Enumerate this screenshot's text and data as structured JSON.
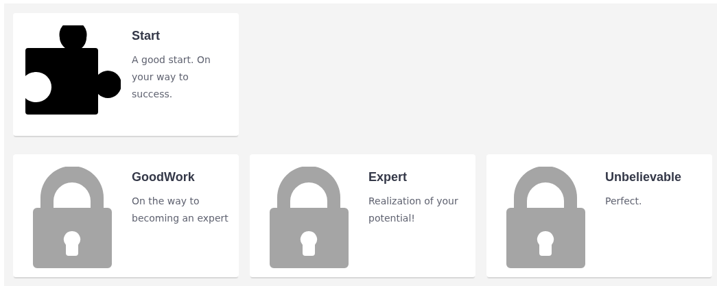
{
  "rows": [
    {
      "achievements": [
        {
          "title": "Start",
          "description": "A good start. On your way to success.",
          "unlocked": true
        }
      ]
    },
    {
      "achievements": [
        {
          "title": "GoodWork",
          "description": "On the way to becoming an expert",
          "unlocked": false
        },
        {
          "title": "Expert",
          "description": "Realization of your potential!",
          "unlocked": false
        },
        {
          "title": "Unbelievable",
          "description": "Perfect.",
          "unlocked": false
        }
      ]
    }
  ]
}
